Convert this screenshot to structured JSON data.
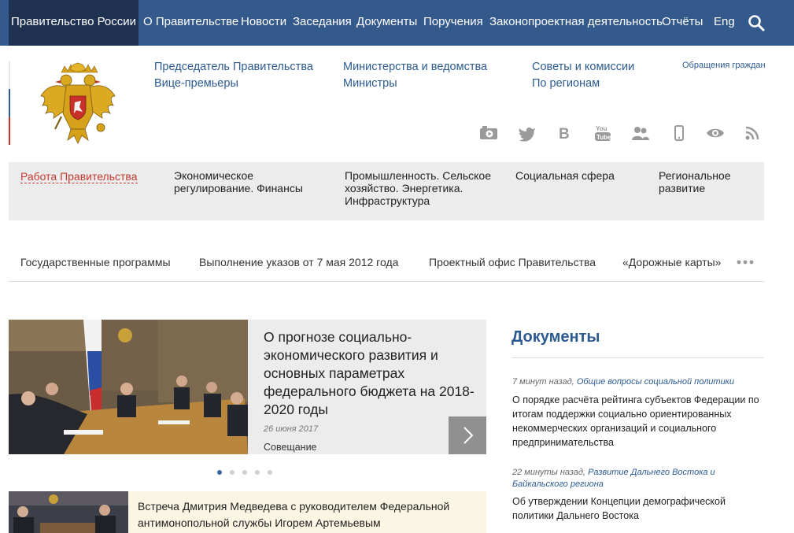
{
  "topnav": {
    "home": "Правительство России",
    "items": [
      "О Правительстве",
      "Новости",
      "Заседания",
      "Документы",
      "Поручения",
      "Законопроектная деятельность",
      "Отчёты",
      "Eng"
    ]
  },
  "header_links": {
    "col1": [
      "Председатель Правительства",
      "Вице-премьеры"
    ],
    "col2": [
      "Министерства и ведомства",
      "Министры"
    ],
    "col3": [
      "Советы и комиссии",
      "По регионам"
    ],
    "appeals": "Обращения граждан"
  },
  "social_icons": [
    "camera-icon",
    "twitter-icon",
    "vk-icon",
    "youtube-icon",
    "people-icon",
    "mobile-icon",
    "eye-icon",
    "rss-icon"
  ],
  "topics": [
    "Работа Правительства",
    "Экономическое регулирование. Финансы",
    "Промышленность. Сельское хозяйство. Энергетика. Инфраструктура",
    "Социальная сфера",
    "Региональное развитие"
  ],
  "programs": [
    "Государственные программы",
    "Выполнение указов от 7 мая 2012 года",
    "Проектный офис Правительства",
    "«Дорожные карты»"
  ],
  "feature": {
    "title": "О прогнозе социально-экономического развития и основных параметрах федерального бюджета на 2018-2020 годы",
    "date": "26 июня 2017",
    "type": "Совещание",
    "slides": 5,
    "active_slide": 1
  },
  "news2": {
    "title": "Встреча Дмитрия Медведева с руководителем Федеральной антимонопольной службы Игорем Артемьевым"
  },
  "documents": {
    "title": "Документы",
    "items": [
      {
        "time": "7 минут назад,",
        "category": "Общие вопросы социальной политики",
        "text": "О порядке расчёта рейтинга субъектов Федерации по итогам поддержки социально ориентированных некоммерческих организаций и социального предпринимательства"
      },
      {
        "time": "22 минуты назад,",
        "category": "Развитие Дальнего Востока и Байкальского региона",
        "text": "Об утверждении Концепции демографической политики Дальнего Востока"
      }
    ]
  },
  "colors": {
    "topbar": "#34598b",
    "home_bg": "#1f3151",
    "link": "#2b5a91",
    "active": "#c53a33",
    "panel": "#ececec"
  }
}
